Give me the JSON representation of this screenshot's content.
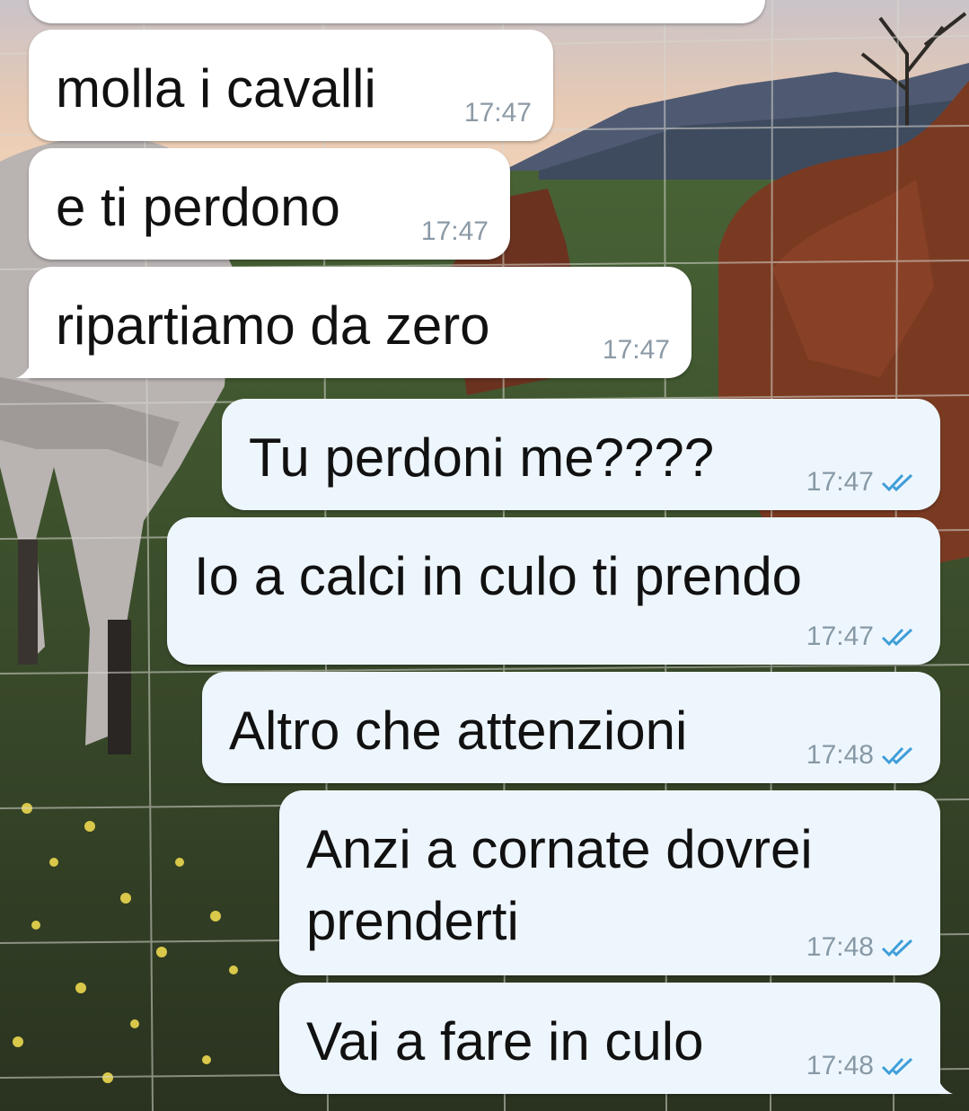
{
  "colors": {
    "incoming_bubble": "#ffffff",
    "outgoing_bubble": "#eef6fd",
    "read_check": "#3f9ed8",
    "timestamp": "#8c9aa6"
  },
  "wallpaper": {
    "icon": "horses-field-photo"
  },
  "messages": [
    {
      "dir": "in",
      "text": "molla i cavalli",
      "time": "17:47"
    },
    {
      "dir": "in",
      "text": "e ti perdono",
      "time": "17:47"
    },
    {
      "dir": "in",
      "text": "ripartiamo da zero",
      "time": "17:47"
    },
    {
      "dir": "out",
      "text": "Tu perdoni me????",
      "time": "17:47",
      "status": "read"
    },
    {
      "dir": "out",
      "text": "Io a calci in culo ti prendo",
      "time": "17:47",
      "status": "read"
    },
    {
      "dir": "out",
      "text": "Altro che attenzioni",
      "time": "17:48",
      "status": "read"
    },
    {
      "dir": "out",
      "text_line1": "Anzi a cornate dovrei",
      "text_line2": "prenderti",
      "time": "17:48",
      "status": "read"
    },
    {
      "dir": "out",
      "text": "Vai a fare in culo",
      "time": "17:48",
      "status": "read"
    }
  ]
}
